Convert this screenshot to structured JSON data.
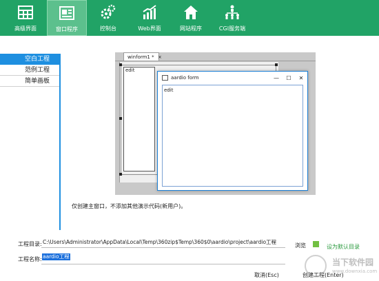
{
  "toolbar": {
    "items": [
      {
        "label": "高级界面",
        "icon": "table-icon"
      },
      {
        "label": "窗口程序",
        "icon": "window-form-icon"
      },
      {
        "label": "控制台",
        "icon": "gears-icon"
      },
      {
        "label": "Web界面",
        "icon": "chart-growth-icon"
      },
      {
        "label": "网站程序",
        "icon": "house-icon"
      },
      {
        "label": "CGI服务端",
        "icon": "network-people-icon"
      }
    ],
    "active_index": 1,
    "background": "#21a366"
  },
  "sidebar": {
    "items": [
      {
        "label": "空白工程"
      },
      {
        "label": "范例工程"
      },
      {
        "label": "简单画板"
      }
    ],
    "active_index": 0,
    "accent": "#1e8fe0"
  },
  "preview": {
    "tab_label": "winform1 *",
    "tab_close": "×",
    "design_text": "edit",
    "window_title": "aardio form",
    "window_controls": [
      "—",
      "☐",
      "✕"
    ],
    "window_text": "edit"
  },
  "hint": "仅创建主窗口，不添加其他演示代码(新用户)。",
  "form": {
    "dir_label": "工程目录:",
    "dir_value": "C:\\Users\\Administrator\\AppData\\Local\\Temp\\360zip$Temp\\360$0\\aardio\\project\\aardio工程",
    "browse_label": "浏览",
    "default_dir_label": "设为默认目录",
    "name_label": "工程名称:",
    "name_value": "aardio工程"
  },
  "buttons": {
    "cancel": "取消(Esc)",
    "create": "创建工程(Enter)"
  },
  "watermark": {
    "text": "当下软件园",
    "url": "www.downxia.com"
  }
}
